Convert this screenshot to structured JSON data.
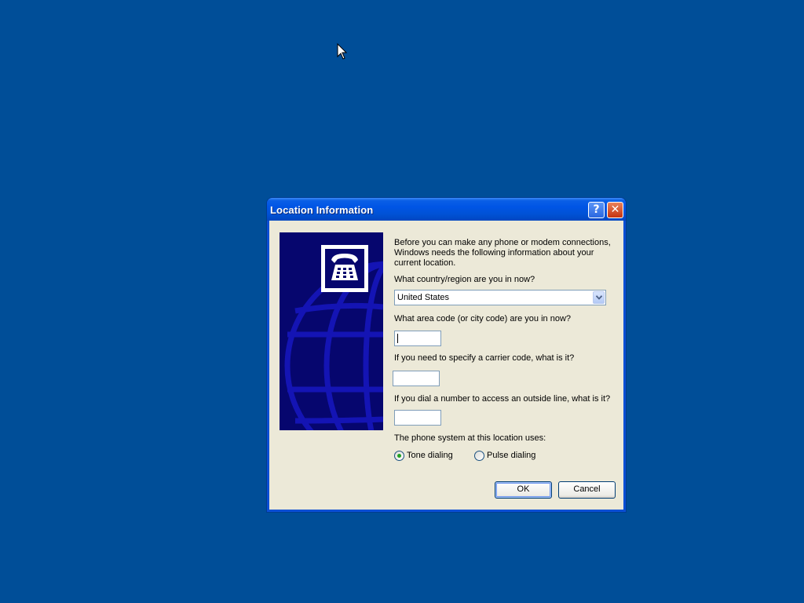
{
  "window": {
    "title": "Location Information",
    "help_glyph": "?",
    "close_glyph": "✕"
  },
  "intro_text": "Before you can make any phone or modem connections, Windows needs the following information about your current location.",
  "country": {
    "label": "What country/region are you in now?",
    "value": "United States"
  },
  "area_code": {
    "label": "What area code (or city code) are you in now?",
    "value": ""
  },
  "carrier_code": {
    "label": "If you need to specify a carrier code, what is it?",
    "value": ""
  },
  "outside_line": {
    "label": "If you dial a number to access an outside line, what is it?",
    "value": ""
  },
  "phone_system": {
    "label": "The phone system at this location uses:",
    "options": [
      {
        "label": "Tone dialing",
        "selected": true
      },
      {
        "label": "Pulse dialing",
        "selected": false
      }
    ]
  },
  "buttons": {
    "ok": "OK",
    "cancel": "Cancel"
  },
  "icons": {
    "cursor": "arrow-cursor-icon",
    "banner": "telephone-icon",
    "globe": "globe-graphic"
  },
  "colors": {
    "desktop": "#004e98",
    "titlebar": "#0055e5",
    "dialog_face": "#ece9d8",
    "banner": "#06066e",
    "radio_selected": "#21a121"
  }
}
